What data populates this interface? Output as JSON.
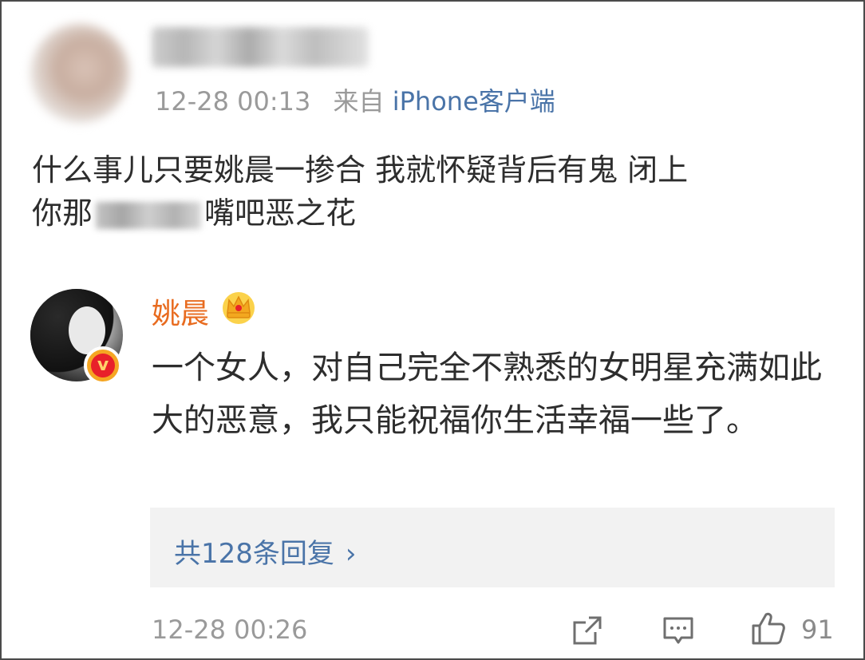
{
  "original_comment": {
    "timestamp": "12-28 00:13",
    "source_label": "来自",
    "source_link": "iPhone客户端",
    "text_line1": "什么事儿只要姚晨一掺合 我就怀疑背后有鬼 闭上",
    "text_line2_start": "你那",
    "text_line2_end": "嘴吧恶之花"
  },
  "reply": {
    "author": "姚晨",
    "text": "一个女人，对自己完全不熟悉的女明星充满如此大的恶意，我只能祝福你生活幸福一些了。",
    "replies_label": "共128条回复",
    "replies_chevron": "›",
    "timestamp": "12-28 00:26",
    "verified_mark": "v",
    "like_count": "91"
  },
  "icons": {
    "verified": "verified-badge-icon",
    "member_crown": "crown-icon",
    "share": "share-icon",
    "comment": "comment-icon",
    "like": "thumbs-up-icon"
  },
  "colors": {
    "username": "#e86b1f",
    "link": "#4a74a8",
    "meta": "#9a9a9a",
    "reply_box_bg": "#f2f2f2"
  }
}
